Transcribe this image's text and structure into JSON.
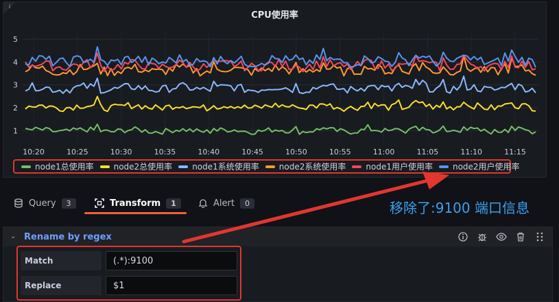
{
  "panel": {
    "title": "CPU使用率",
    "info_icon": "info-icon"
  },
  "chart_data": {
    "type": "line",
    "title": "CPU使用率",
    "ylim": [
      0.5,
      5.3
    ],
    "yticks": [
      "1",
      "2",
      "3",
      "4",
      "5"
    ],
    "x_ticks": [
      "10:20",
      "10:25",
      "10:30",
      "10:35",
      "10:40",
      "10:45",
      "10:50",
      "10:55",
      "11:00",
      "11:05",
      "11:10",
      "11:15"
    ],
    "grid": true,
    "legend_position": "bottom",
    "series": [
      {
        "name": "node1总使用率",
        "color": "#73bf69",
        "base": 1.0,
        "amp": 0.12
      },
      {
        "name": "node2总使用率",
        "color": "#fade2a",
        "base": 2.05,
        "amp": 0.15
      },
      {
        "name": "node1系统使用率",
        "color": "#8ab8ff",
        "base": 2.85,
        "amp": 0.18
      },
      {
        "name": "node2系统使用率",
        "color": "#ff9830",
        "base": 3.65,
        "amp": 0.2
      },
      {
        "name": "node1用户使用率",
        "color": "#f2495c",
        "base": 3.85,
        "amp": 0.2
      },
      {
        "name": "node2用户使用率",
        "color": "#5794f2",
        "base": 4.05,
        "amp": 0.22
      }
    ]
  },
  "tabs": [
    {
      "label": "Query",
      "count": "3",
      "icon": "database-icon"
    },
    {
      "label": "Transform",
      "count": "1",
      "icon": "transform-icon"
    },
    {
      "label": "Alert",
      "count": "0",
      "icon": "bell-icon"
    }
  ],
  "annotation": {
    "text": "移除了:9100 端口信息",
    "color": "#3aa0f0"
  },
  "transform": {
    "title": "Rename by regex",
    "match_label": "Match",
    "match_value": "(.*):9100",
    "replace_label": "Replace",
    "replace_value": "$1",
    "actions": [
      "info-icon",
      "debug-icon",
      "eye-icon",
      "trash-icon",
      "drag-icon"
    ]
  },
  "colors": {
    "accent": "#f55f3e",
    "highlight": "#e0372f",
    "link": "#6e9fff"
  }
}
